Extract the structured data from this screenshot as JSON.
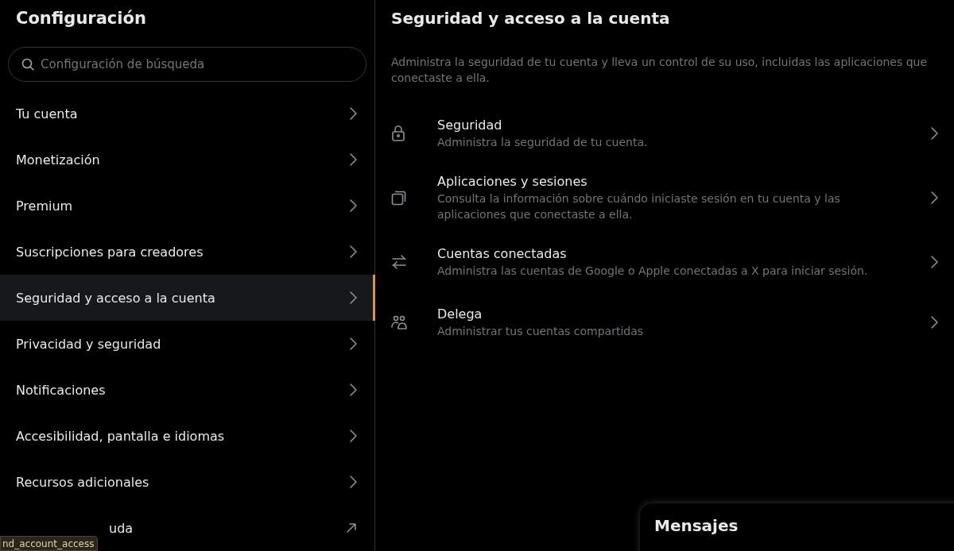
{
  "sidebar": {
    "title": "Configuración",
    "search": {
      "placeholder": "Configuración de búsqueda"
    },
    "items": [
      {
        "label": "Tu cuenta",
        "kind": "chevron",
        "selected": false
      },
      {
        "label": "Monetización",
        "kind": "chevron",
        "selected": false
      },
      {
        "label": "Premium",
        "kind": "chevron",
        "selected": false
      },
      {
        "label": "Suscripciones para creadores",
        "kind": "chevron",
        "selected": false
      },
      {
        "label": "Seguridad y acceso a la cuenta",
        "kind": "chevron",
        "selected": true
      },
      {
        "label": "Privacidad y seguridad",
        "kind": "chevron",
        "selected": false
      },
      {
        "label": "Notificaciones",
        "kind": "chevron",
        "selected": false
      },
      {
        "label": "Accesibilidad, pantalla e idiomas",
        "kind": "chevron",
        "selected": false
      },
      {
        "label": "Recursos adicionales",
        "kind": "chevron",
        "selected": false
      },
      {
        "label": "uda",
        "kind": "external",
        "selected": false
      }
    ]
  },
  "main": {
    "title": "Seguridad y acceso a la cuenta",
    "description": "Administra la seguridad de tu cuenta y lleva un control de su uso, incluidas las aplicaciones que conectaste a ella.",
    "options": [
      {
        "kind": "lock",
        "title": "Seguridad",
        "subtitle": "Administra la seguridad de tu cuenta."
      },
      {
        "kind": "windows",
        "title": "Aplicaciones y sesiones",
        "subtitle": "Consulta la información sobre cuándo iniciaste sesión en tu cuenta y las aplicaciones que conectaste a ella."
      },
      {
        "kind": "arrows",
        "title": "Cuentas conectadas",
        "subtitle": "Administra las cuentas de Google o Apple conectadas a X para iniciar sesión."
      },
      {
        "kind": "people",
        "title": "Delega",
        "subtitle": "Administrar tus cuentas compartidas"
      }
    ]
  },
  "messages_drawer": {
    "title": "Mensajes"
  },
  "status_tooltip": "nd_account_access"
}
